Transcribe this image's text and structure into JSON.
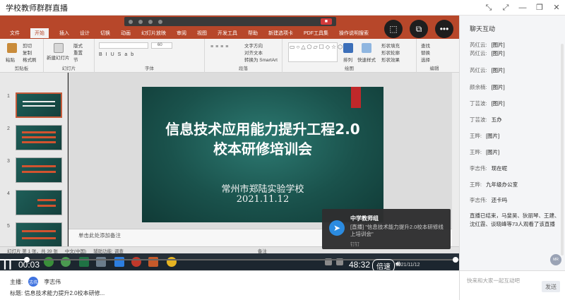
{
  "window": {
    "title": "学校教师群群直播",
    "controls": [
      "shrink-icon",
      "fullscreen-icon",
      "minimize-icon",
      "restore-icon",
      "close-icon"
    ]
  },
  "ppt": {
    "tabs": [
      "文件",
      "开始",
      "插入",
      "设计",
      "切换",
      "动画",
      "幻灯片放映",
      "审阅",
      "视图",
      "开发工具",
      "帮助",
      "新建选项卡",
      "PDF工具集",
      "操作说明搜索"
    ],
    "active_tab": "开始",
    "ribbon_groups": [
      {
        "label": "剪贴板",
        "items": [
          "粘贴",
          "剪切",
          "复制",
          "格式刷"
        ]
      },
      {
        "label": "幻灯片",
        "items": [
          "新建幻灯片",
          "版式",
          "重置",
          "节"
        ]
      },
      {
        "label": "字体",
        "items": [
          "60"
        ]
      },
      {
        "label": "段落",
        "items": [
          "文字方向",
          "对齐文本",
          "转换为 SmartArt"
        ]
      },
      {
        "label": "绘图",
        "items": [
          "排列",
          "快速样式",
          "形状填充",
          "形状轮廓",
          "形状效果"
        ]
      },
      {
        "label": "编辑",
        "items": [
          "查找",
          "替换",
          "选择"
        ]
      }
    ],
    "slide_numbers": [
      "1",
      "2",
      "3",
      "4",
      "5"
    ],
    "slide": {
      "title_line1": "信息技术应用能力提升工程2.0",
      "title_line2": "校本研修培训会",
      "school": "常州市郑陆实验学校",
      "date": "2021.11.12"
    },
    "notes_placeholder": "单击此处添加备注",
    "status": {
      "slide_count": "幻灯片 第 1 张，共 39 张",
      "language": "中文(中国)",
      "accessibility": "辅助功能: 调查",
      "notes": "备注"
    },
    "taskbar_date": "2021/11/12"
  },
  "notification": {
    "title": "中学教师组",
    "message": "[直播] \"信息技术能力提升2.0校本研修线上培训会\"",
    "sub": "钉钉"
  },
  "player": {
    "current_time": "00:03",
    "total_time": "48:32",
    "speed_label": "倍速",
    "progress": 0.001
  },
  "host": {
    "label": "主播:",
    "name": "李志伟",
    "avatar": "志伟",
    "topic_label": "标题:",
    "topic": "信息技术能力提升2.0校本研修..."
  },
  "chat": {
    "header": "聊天互动",
    "messages": [
      {
        "name": "芮红云:",
        "content": "[图片]"
      },
      {
        "name": "芮红云:",
        "content": "[图片]"
      },
      {
        "name": "芮红云:",
        "content": "[图片]"
      },
      {
        "name": "颜余楠:",
        "content": "[图片]"
      },
      {
        "name": "丁芸波:",
        "content": "[图片]"
      },
      {
        "name": "丁芸波:",
        "content": "五办"
      },
      {
        "name": "王晔:",
        "content": "[图片]"
      },
      {
        "name": "王晔:",
        "content": "[图片]"
      },
      {
        "name": "李志伟:",
        "content": "现在呢"
      },
      {
        "name": "王晔:",
        "content": "九年级办公室"
      },
      {
        "name": "李志伟:",
        "content": "还卡吗"
      }
    ],
    "system_message": "直播已结束，马斐昊、狄丽琴、王建、沈红霞、谈晓峰等73人观看了该直播",
    "like_badge": "MR",
    "input_placeholder": "快来和大家一起互动吧",
    "send_label": "发送"
  }
}
